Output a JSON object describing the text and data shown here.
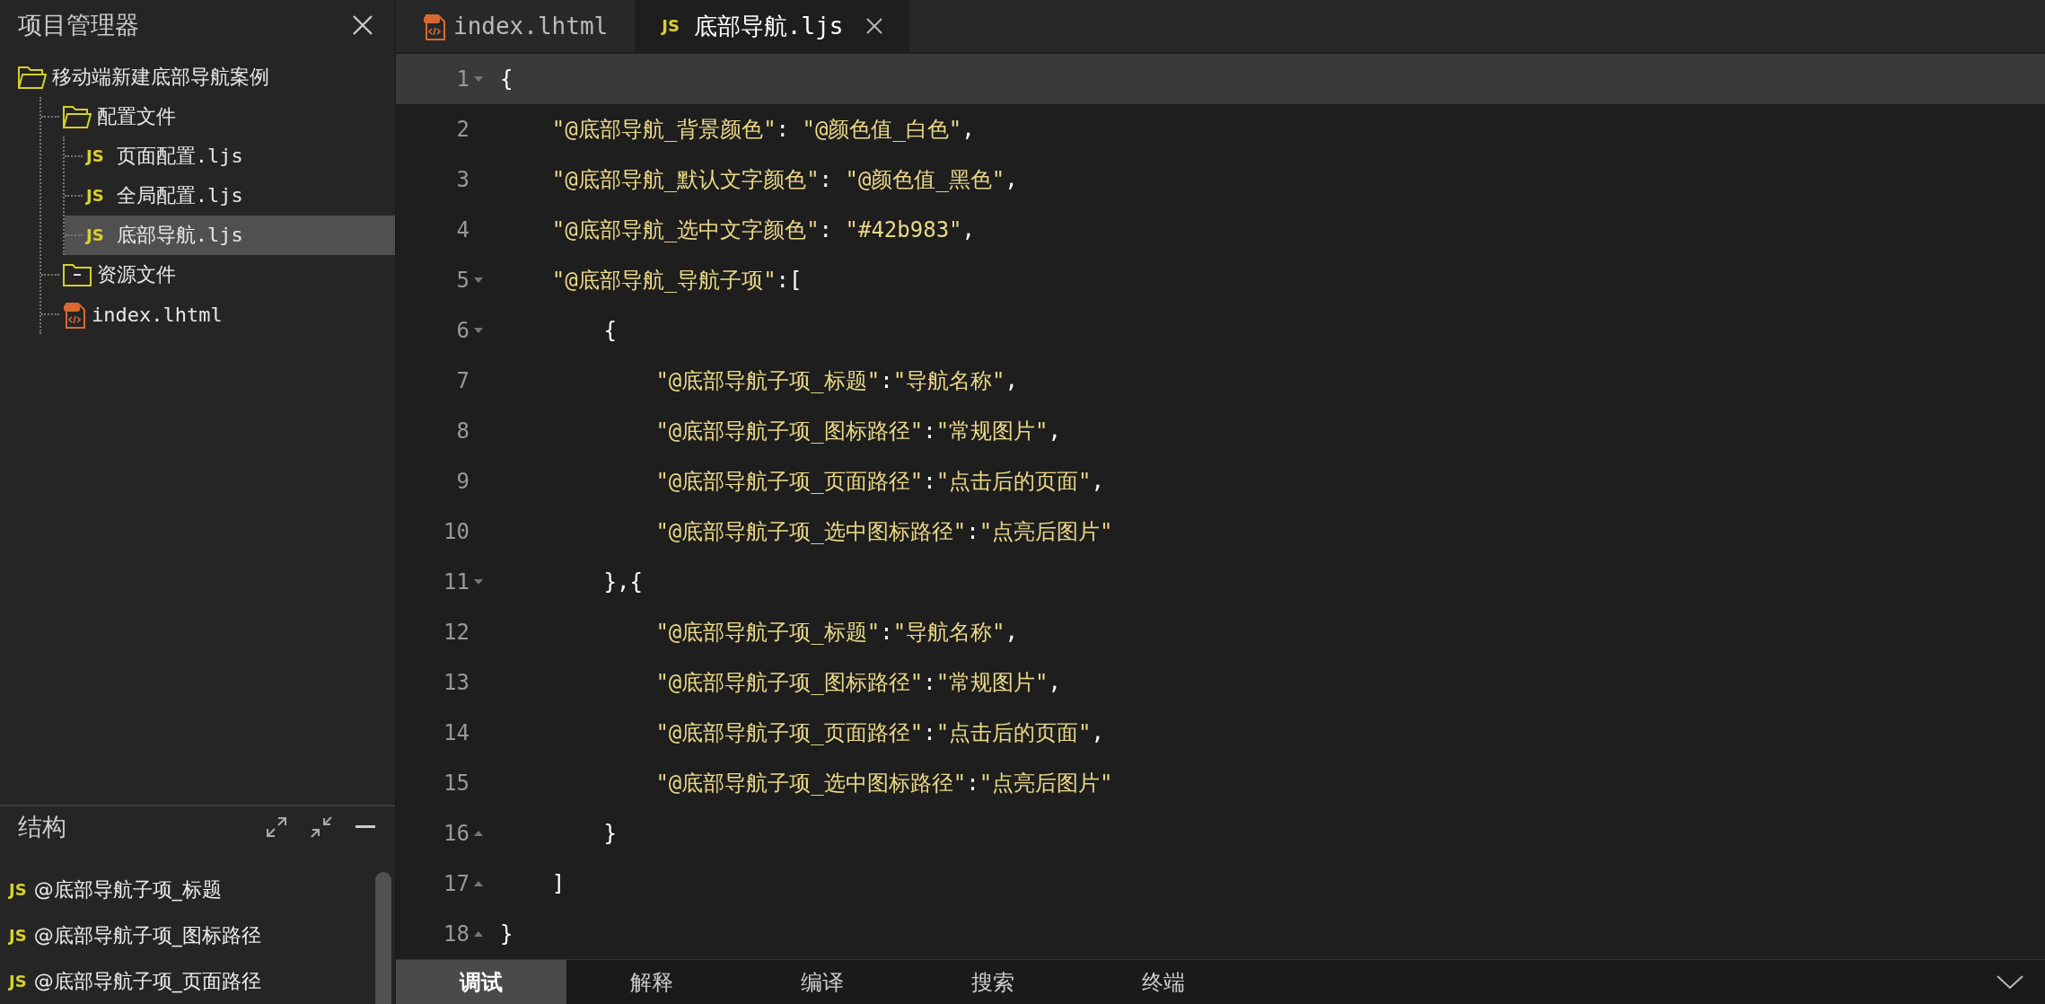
{
  "explorer": {
    "title": "项目管理器",
    "tree": [
      {
        "label": "移动端新建底部导航案例",
        "kind": "folder",
        "expanded": true,
        "selected": false,
        "children": [
          {
            "label": "配置文件",
            "kind": "folder",
            "expanded": true,
            "selected": false,
            "children": [
              {
                "label": "页面配置.ljs",
                "kind": "js",
                "badge": "JS",
                "selected": false
              },
              {
                "label": "全局配置.ljs",
                "kind": "js",
                "badge": "JS",
                "selected": false
              },
              {
                "label": "底部导航.ljs",
                "kind": "js",
                "badge": "JS",
                "selected": true
              }
            ]
          },
          {
            "label": "资源文件",
            "kind": "folder",
            "expanded": false,
            "selected": false
          },
          {
            "label": "index.lhtml",
            "kind": "html",
            "selected": false
          }
        ]
      }
    ]
  },
  "outline": {
    "title": "结构",
    "items": [
      {
        "label": "@底部导航子项_标题",
        "kind": "js",
        "badge": "JS"
      },
      {
        "label": "@底部导航子项_图标路径",
        "kind": "js",
        "badge": "JS"
      },
      {
        "label": "@底部导航子项_页面路径",
        "kind": "js",
        "badge": "JS"
      }
    ]
  },
  "tabs": [
    {
      "label": "index.lhtml",
      "kind": "html",
      "selected": false
    },
    {
      "label": "底部导航.ljs",
      "kind": "js",
      "badge": "JS",
      "selected": true
    }
  ],
  "editor": {
    "lines": [
      {
        "number": "1",
        "text": "{",
        "kind": "fold-start",
        "current": true
      },
      {
        "number": "2",
        "text": "    \"@底部导航_背景颜色\": \"@颜色值_白色\",",
        "kind": "plain",
        "current": false
      },
      {
        "number": "3",
        "text": "    \"@底部导航_默认文字颜色\": \"@颜色值_黑色\",",
        "kind": "plain",
        "current": false
      },
      {
        "number": "4",
        "text": "    \"@底部导航_选中文字颜色\": \"#42b983\",",
        "kind": "plain",
        "current": false
      },
      {
        "number": "5",
        "text": "    \"@底部导航_导航子项\":[",
        "kind": "fold-start",
        "current": false
      },
      {
        "number": "6",
        "text": "        {",
        "kind": "fold-start",
        "current": false
      },
      {
        "number": "7",
        "text": "            \"@底部导航子项_标题\":\"导航名称\",",
        "kind": "plain",
        "current": false
      },
      {
        "number": "8",
        "text": "            \"@底部导航子项_图标路径\":\"常规图片\",",
        "kind": "plain",
        "current": false
      },
      {
        "number": "9",
        "text": "            \"@底部导航子项_页面路径\":\"点击后的页面\",",
        "kind": "plain",
        "current": false
      },
      {
        "number": "10",
        "text": "            \"@底部导航子项_选中图标路径\":\"点亮后图片\"",
        "kind": "plain",
        "current": false
      },
      {
        "number": "11",
        "text": "        },{",
        "kind": "fold-start",
        "current": false
      },
      {
        "number": "12",
        "text": "            \"@底部导航子项_标题\":\"导航名称\",",
        "kind": "plain",
        "current": false
      },
      {
        "number": "13",
        "text": "            \"@底部导航子项_图标路径\":\"常规图片\",",
        "kind": "plain",
        "current": false
      },
      {
        "number": "14",
        "text": "            \"@底部导航子项_页面路径\":\"点击后的页面\",",
        "kind": "plain",
        "current": false
      },
      {
        "number": "15",
        "text": "            \"@底部导航子项_选中图标路径\":\"点亮后图片\"",
        "kind": "plain",
        "current": false
      },
      {
        "number": "16",
        "text": "        }",
        "kind": "fold-end",
        "current": false
      },
      {
        "number": "17",
        "text": "    ]",
        "kind": "fold-end",
        "current": false
      },
      {
        "number": "18",
        "text": "}",
        "kind": "fold-end",
        "current": false
      }
    ]
  },
  "bottom_tabs": [
    {
      "label": "调试",
      "selected": true
    },
    {
      "label": "解释",
      "selected": false
    },
    {
      "label": "编译",
      "selected": false
    },
    {
      "label": "搜索",
      "selected": false
    },
    {
      "label": "终端",
      "selected": false
    }
  ]
}
